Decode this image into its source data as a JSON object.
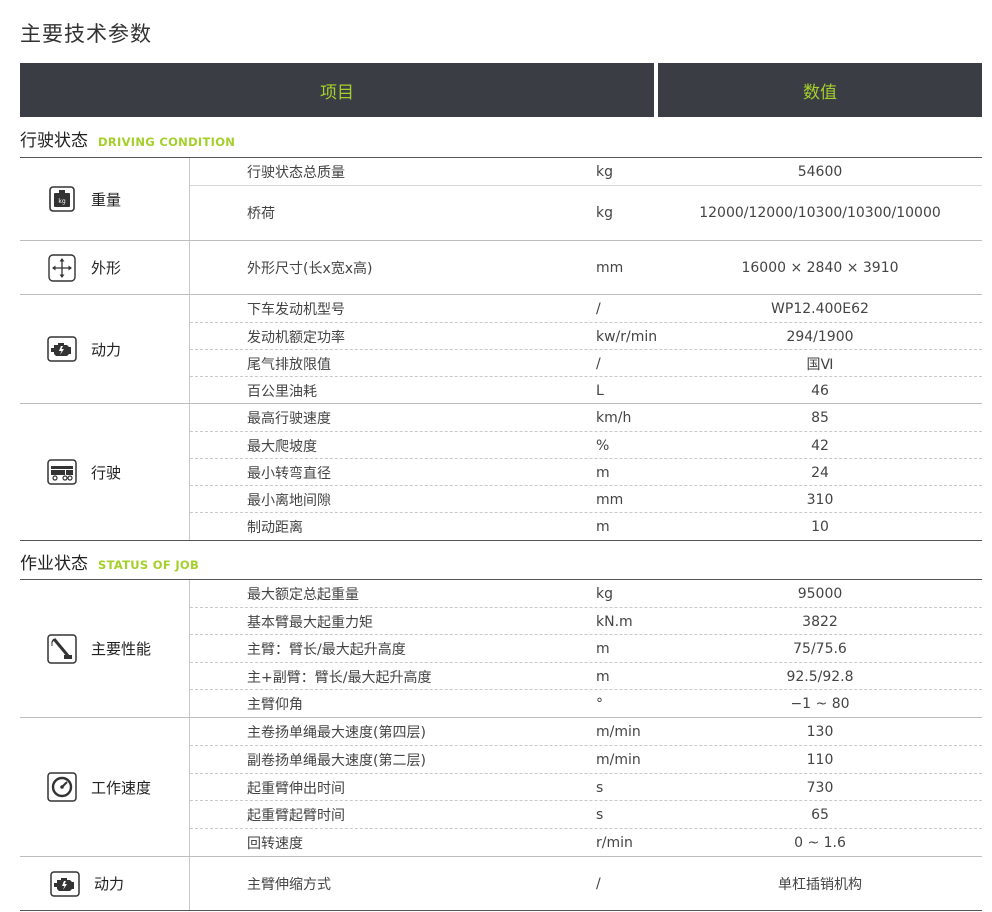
{
  "page_title": "主要技术参数",
  "header": {
    "item": "项目",
    "value": "数值"
  },
  "sections": {
    "driving": {
      "title": "行驶状态",
      "title_en": "DRIVING CONDITION"
    },
    "job": {
      "title": "作业状态",
      "title_en": "STATUS OF JOB"
    }
  },
  "groups": {
    "weight": {
      "label": "重量",
      "icon": "weight-kg-icon",
      "rows": [
        {
          "name": "行驶状态总质量",
          "unit": "kg",
          "value": "54600"
        },
        {
          "name": "桥荷",
          "unit": "kg",
          "value": "12000/12000/10300/10300/10000"
        }
      ]
    },
    "shape": {
      "label": "外形",
      "icon": "dimensions-arrows-icon",
      "rows": [
        {
          "name": "外形尺寸(长x宽x高)",
          "unit": "mm",
          "value": "16000 × 2840 × 3910"
        }
      ]
    },
    "power": {
      "label": "动力",
      "icon": "engine-icon",
      "rows": [
        {
          "name": "下车发动机型号",
          "unit": "/",
          "value": "WP12.400E62"
        },
        {
          "name": "发动机额定功率",
          "unit": "kw/r/min",
          "value": "294/1900"
        },
        {
          "name": "尾气排放限值",
          "unit": "/",
          "value": "国Ⅵ"
        },
        {
          "name": "百公里油耗",
          "unit": "L",
          "value": "46"
        }
      ]
    },
    "travel": {
      "label": "行驶",
      "icon": "truck-icon",
      "rows": [
        {
          "name": "最高行驶速度",
          "unit": "km/h",
          "value": "85"
        },
        {
          "name": "最大爬坡度",
          "unit": "%",
          "value": "42"
        },
        {
          "name": "最小转弯直径",
          "unit": "m",
          "value": "24"
        },
        {
          "name": "最小离地间隙",
          "unit": "mm",
          "value": "310"
        },
        {
          "name": "制动距离",
          "unit": "m",
          "value": "10"
        }
      ]
    },
    "performance": {
      "label": "主要性能",
      "icon": "crane-boom-icon",
      "rows": [
        {
          "name": "最大额定总起重量",
          "unit": "kg",
          "value": "95000"
        },
        {
          "name": "基本臂最大起重力矩",
          "unit": "kN.m",
          "value": "3822"
        },
        {
          "name": "主臂：臂长/最大起升高度",
          "unit": "m",
          "value": "75/75.6"
        },
        {
          "name": "主+副臂：臂长/最大起升高度",
          "unit": "m",
          "value": "92.5/92.8"
        },
        {
          "name": "主臂仰角",
          "unit": "°",
          "value": "−1 ~ 80"
        }
      ]
    },
    "speed": {
      "label": "工作速度",
      "icon": "speedometer-icon",
      "rows": [
        {
          "name": "主卷扬单绳最大速度(第四层)",
          "unit": "m/min",
          "value": "130"
        },
        {
          "name": "副卷扬单绳最大速度(第二层)",
          "unit": "m/min",
          "value": "110"
        },
        {
          "name": "起重臂伸出时间",
          "unit": "s",
          "value": "730"
        },
        {
          "name": "起重臂起臂时间",
          "unit": "s",
          "value": "65"
        },
        {
          "name": "回转速度",
          "unit": "r/min",
          "value": "0 ~ 1.6"
        }
      ]
    },
    "power2": {
      "label": "动力",
      "icon": "engine-icon",
      "rows": [
        {
          "name": "主臂伸缩方式",
          "unit": "/",
          "value": "单杠插销机构"
        }
      ]
    }
  },
  "colors": {
    "header_bg": "#3a3d44",
    "accent": "#a5cf2b"
  }
}
